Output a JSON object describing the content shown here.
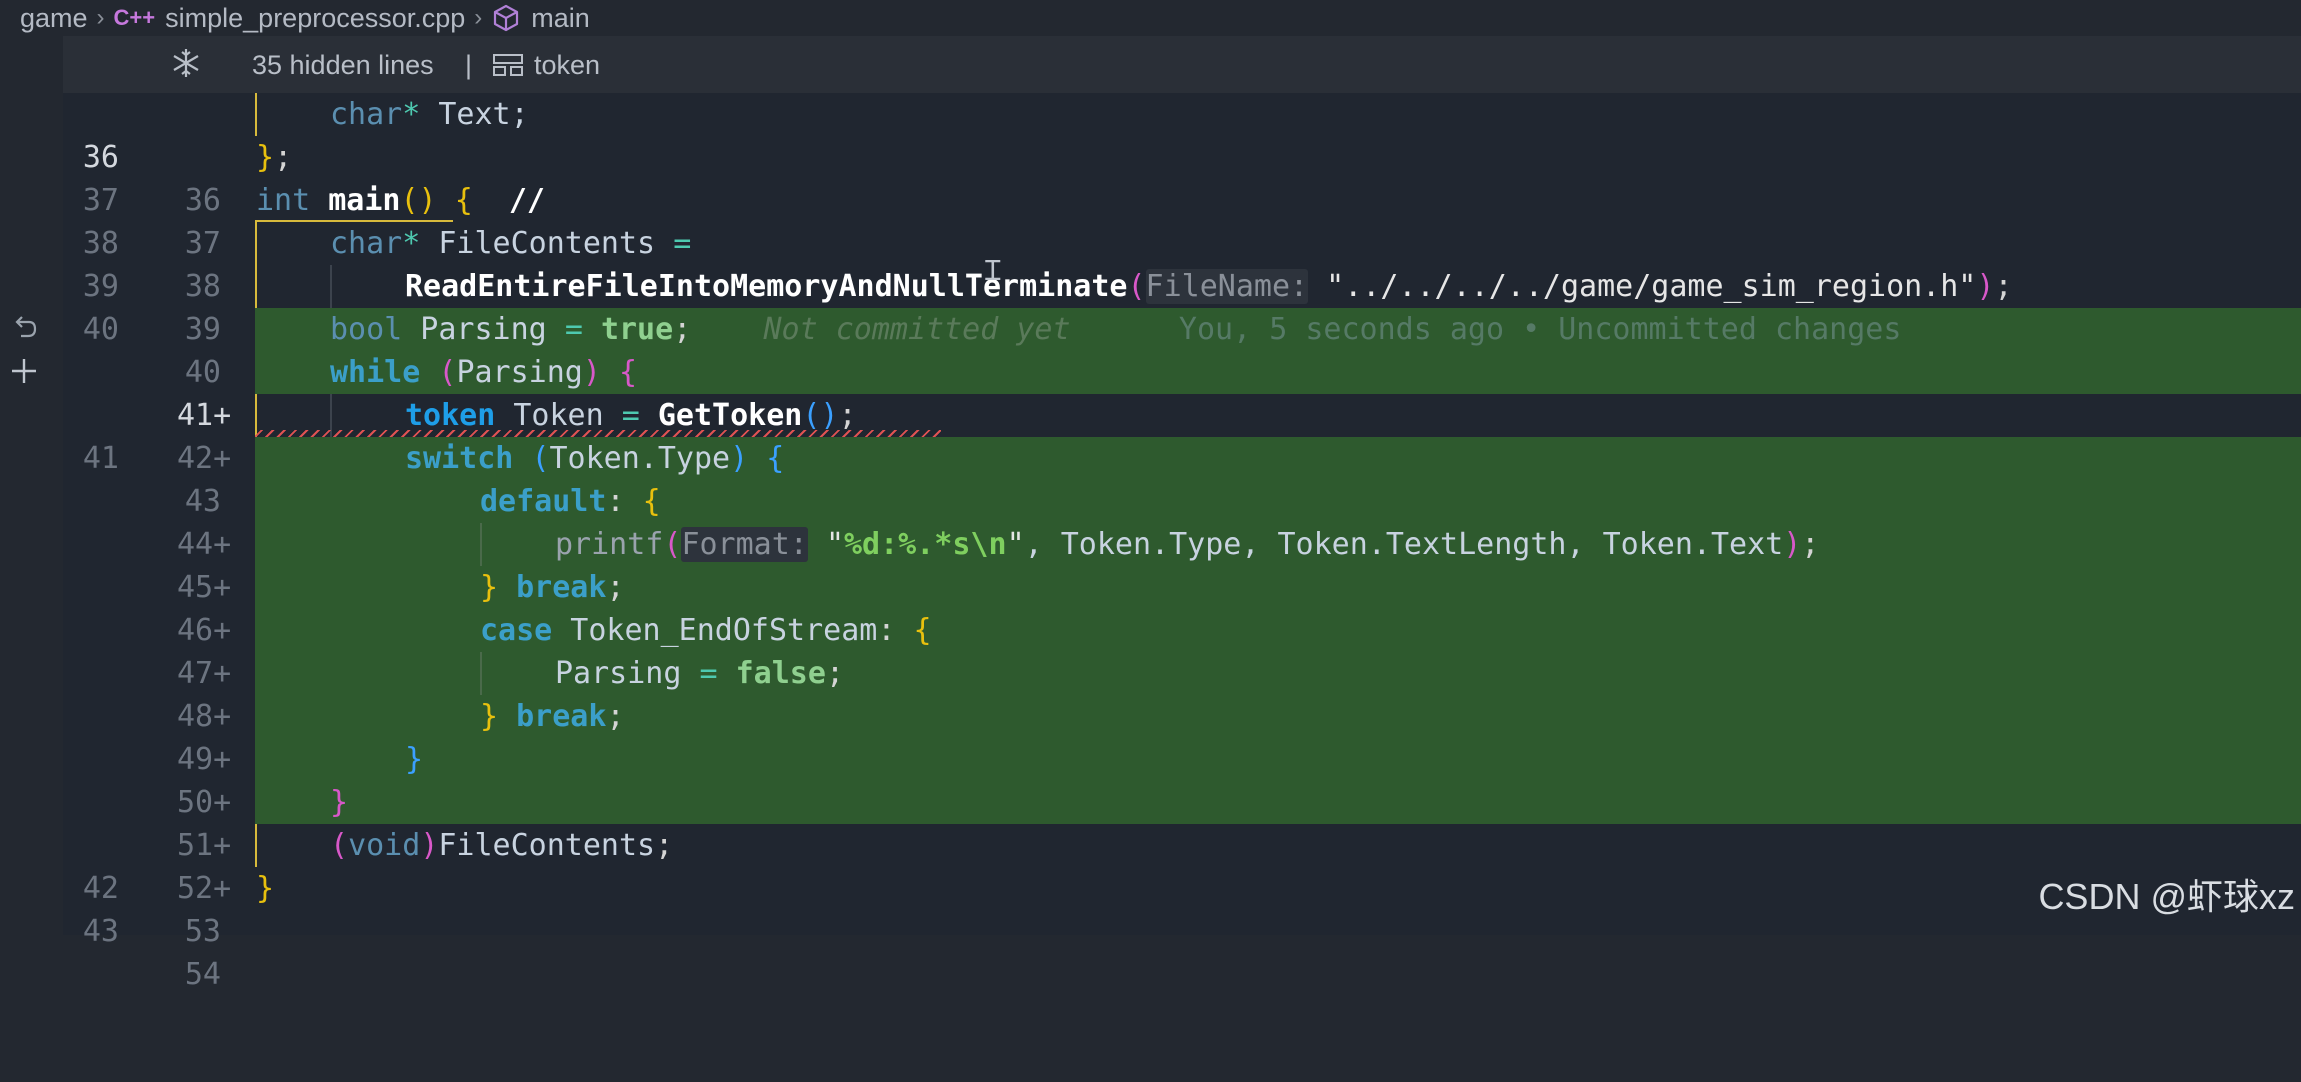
{
  "breadcrumb": {
    "folder": "game",
    "file": "simple_preprocessor.cpp",
    "file_icon": "C++",
    "symbol": "main"
  },
  "fold": {
    "hidden_lines": "35 hidden lines",
    "separator": "|",
    "symbol": "token"
  },
  "lines": [
    {
      "old": "36",
      "new": "36"
    },
    {
      "old": "37",
      "new": "37"
    },
    {
      "old": "38",
      "new": "38"
    },
    {
      "old": "39",
      "new": "39"
    },
    {
      "old": "40",
      "new": "40"
    },
    {
      "old": "",
      "new": "41+"
    },
    {
      "old": "",
      "new": "42+"
    },
    {
      "old": "41",
      "new": "43"
    },
    {
      "old": "",
      "new": "44+"
    },
    {
      "old": "",
      "new": "45+"
    },
    {
      "old": "",
      "new": "46+"
    },
    {
      "old": "",
      "new": "47+"
    },
    {
      "old": "",
      "new": "48+"
    },
    {
      "old": "",
      "new": "49+"
    },
    {
      "old": "",
      "new": "50+"
    },
    {
      "old": "",
      "new": "51+"
    },
    {
      "old": "",
      "new": "52+"
    },
    {
      "old": "42",
      "new": "53"
    },
    {
      "old": "43",
      "new": "54"
    }
  ],
  "code": {
    "l36": {
      "kw": "char",
      "op": "*",
      "rest": " Text;"
    },
    "l37": {
      "close": "}",
      "semi": ";"
    },
    "l38": {
      "kw": "int",
      "fn": "main",
      "paren": "()",
      "brace": "{",
      "comment": "//"
    },
    "l39": {
      "kw": "char",
      "op": "*",
      "name": " FileContents ",
      "eq": "="
    },
    "l40": {
      "fn": "ReadEntireFileIntoMemoryAndNullTerminate",
      "open": "(",
      "hint": "FileName:",
      "str": "\"../../../../game/game_sim_region.h\"",
      "close": ")",
      "semi": ";"
    },
    "l41": {
      "type": "bool",
      "name": " Parsing ",
      "eq": "=",
      "val": "true",
      "semi": ";",
      "blame": "Not committed yet",
      "blame_detail": "You, 5 seconds ago • Uncommitted changes"
    },
    "l42": {
      "kw": "while",
      "open": "(",
      "name": "Parsing",
      "close": ")",
      "brace": "{"
    },
    "l43": {
      "type": "token",
      "name": " Token ",
      "eq": "=",
      "fn": "GetToken",
      "paren": "()",
      "semi": ";"
    },
    "l44": {
      "kw": "switch",
      "open": "(",
      "name": "Token.Type",
      "close": ")",
      "brace": "{"
    },
    "l45": {
      "kw": "default",
      "colon": ":",
      "brace": "{"
    },
    "l46": {
      "fn": "printf",
      "open": "(",
      "hint": "Format:",
      "str1": "\"",
      "esc": "%d:%.*s\\n",
      "str2": "\"",
      "args": ", Token.Type, Token.TextLength, Token.Text",
      "close": ")",
      "semi": ";"
    },
    "l47": {
      "brace": "}",
      "kw": "break",
      "semi": ";"
    },
    "l48": {
      "kw": "case",
      "name": " Token_EndOfStream",
      "colon": ":",
      "brace": "{"
    },
    "l49": {
      "name": "Parsing ",
      "eq": "=",
      "val": "false",
      "semi": ";"
    },
    "l50": {
      "brace": "}",
      "kw": "break",
      "semi": ";"
    },
    "l51": {
      "brace": "}"
    },
    "l52": {
      "brace": "}"
    },
    "l53": {
      "open": "(",
      "kw": "void",
      "close": ")",
      "name": "FileContents",
      "semi": ";"
    },
    "l54": {
      "brace": "}"
    }
  },
  "watermark": "CSDN @虾球xz",
  "colors": {
    "added_bg": "#2e5a2e",
    "editor_bg": "#202630",
    "fold_bg": "#2a2f37"
  }
}
